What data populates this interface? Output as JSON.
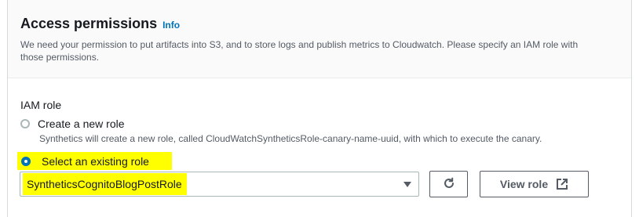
{
  "section": {
    "title": "Access permissions",
    "info_label": "Info",
    "description": "We need your permission to put artifacts into S3, and to store logs and publish metrics to Cloudwatch. Please specify an IAM role with those permissions."
  },
  "iam_role": {
    "label": "IAM role",
    "options": [
      {
        "label": "Create a new role",
        "description": "Synthetics will create a new role, called CloudWatchSyntheticsRole-canary-name-uuid, with which to execute the canary.",
        "selected": false
      },
      {
        "label": "Select an existing role",
        "selected": true
      }
    ],
    "selected_role": "SyntheticsCognitoBlogPostRole",
    "view_role_label": "View role",
    "refresh_icon": "refresh-icon",
    "external_icon": "external-link-icon",
    "dropdown_icon": "caret-down-icon"
  },
  "colors": {
    "highlight": "#ffff00",
    "accent": "#0073bb",
    "border": "#aab7b8"
  }
}
